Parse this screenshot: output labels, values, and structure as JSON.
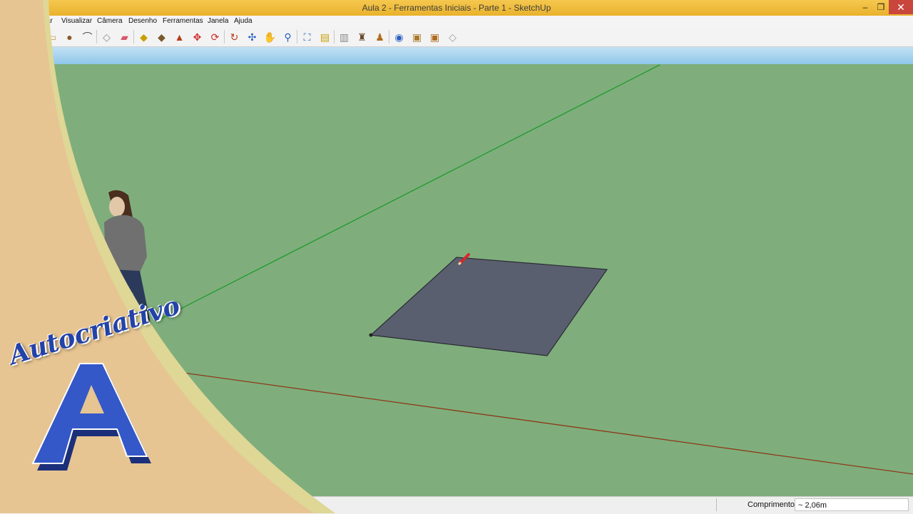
{
  "window": {
    "title": "Aula 2 - Ferramentas Iniciais - Parte 1 - SketchUp",
    "minimize_glyph": "–",
    "maximize_glyph": "❐",
    "close_glyph": "✕"
  },
  "menu": {
    "items": [
      "itar",
      "Visualizar",
      "Câmera",
      "Desenho",
      "Ferramentas",
      "Janela",
      "Ajuda"
    ]
  },
  "toolbar": {
    "tools": [
      {
        "name": "rectangle-tool-icon",
        "glyph": "▭",
        "color": "#c9a25a"
      },
      {
        "name": "circle-tool-icon",
        "glyph": "●",
        "color": "#8a5a2b"
      },
      {
        "name": "arc-tool-icon",
        "glyph": "⌒",
        "color": "#444444"
      },
      {
        "name": "make-component-icon",
        "glyph": "◇",
        "color": "#8a8a8a"
      },
      {
        "name": "eraser-icon",
        "glyph": "▰",
        "color": "#d9576b"
      },
      {
        "name": "tape-measure-icon",
        "glyph": "◆",
        "color": "#c8a000"
      },
      {
        "name": "paint-bucket-icon",
        "glyph": "◆",
        "color": "#7a5a2a"
      },
      {
        "name": "push-pull-icon",
        "glyph": "▲",
        "color": "#b43c1c"
      },
      {
        "name": "move-icon",
        "glyph": "✥",
        "color": "#d22b2b"
      },
      {
        "name": "rotate-icon",
        "glyph": "⟳",
        "color": "#d22b2b"
      },
      {
        "name": "follow-me-icon",
        "glyph": "↻",
        "color": "#b43c1c"
      },
      {
        "name": "orbit-icon",
        "glyph": "✣",
        "color": "#2a5fbf"
      },
      {
        "name": "pan-icon",
        "glyph": "✋",
        "color": "#666666"
      },
      {
        "name": "zoom-icon",
        "glyph": "⚲",
        "color": "#2a5fbf"
      },
      {
        "name": "zoom-extents-icon",
        "glyph": "⛶",
        "color": "#2a5fbf"
      },
      {
        "name": "previous-view-icon",
        "glyph": "▤",
        "color": "#c8a000"
      },
      {
        "name": "next-view-icon",
        "glyph": "▥",
        "color": "#8a8a8a"
      },
      {
        "name": "position-camera-icon",
        "glyph": "♜",
        "color": "#6a4a2a"
      },
      {
        "name": "walk-icon",
        "glyph": "♟",
        "color": "#b06a1c"
      },
      {
        "name": "look-around-icon",
        "glyph": "◉",
        "color": "#2a5fbf"
      },
      {
        "name": "warehouse-icon",
        "glyph": "▣",
        "color": "#a87a2a"
      },
      {
        "name": "share-model-icon",
        "glyph": "▣",
        "color": "#b06a1c"
      },
      {
        "name": "extension-warehouse-icon",
        "glyph": "◇",
        "color": "#9a9a9a"
      }
    ]
  },
  "status": {
    "measure_label": "Comprimento",
    "measure_value": "~ 2,06m"
  },
  "overlay": {
    "logo_text": "Autocriativo",
    "logo_letter": "A"
  },
  "colors": {
    "ground": "#7fae7c",
    "face": "#5a5f6f",
    "green_axis": "#1f9a2a",
    "red_axis": "#8b3a1a",
    "titlebar": "#f0bf3e",
    "overlay_tan": "#e7c592",
    "logo_blue": "#2443a8"
  }
}
